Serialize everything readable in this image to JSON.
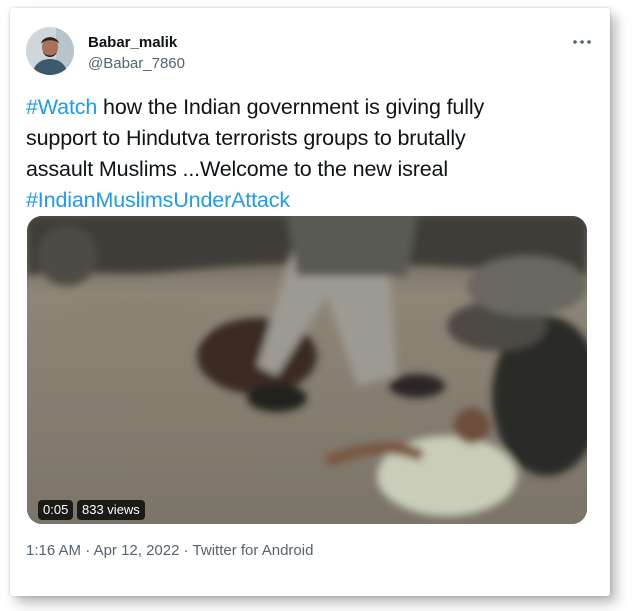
{
  "tweet": {
    "author_name": "Babar_malik",
    "author_handle": "@Babar_7860",
    "more_icon": "ellipsis-icon",
    "lines": [
      {
        "tag": "#Watch",
        "rest": " how the Indian government is giving fully"
      },
      {
        "text": "support to Hindutva terrorists groups to brutally"
      },
      {
        "text": "assault Muslims ...Welcome to the new isreal"
      },
      {
        "tag": "#IndianMuslimsUnderAttack"
      }
    ],
    "video": {
      "duration": "0:05",
      "views": "833 views"
    },
    "time": "1:16 AM",
    "separator": " · ",
    "date": "Apr 12, 2022",
    "source": "Twitter for Android",
    "link_color": "#1d9bf0"
  }
}
